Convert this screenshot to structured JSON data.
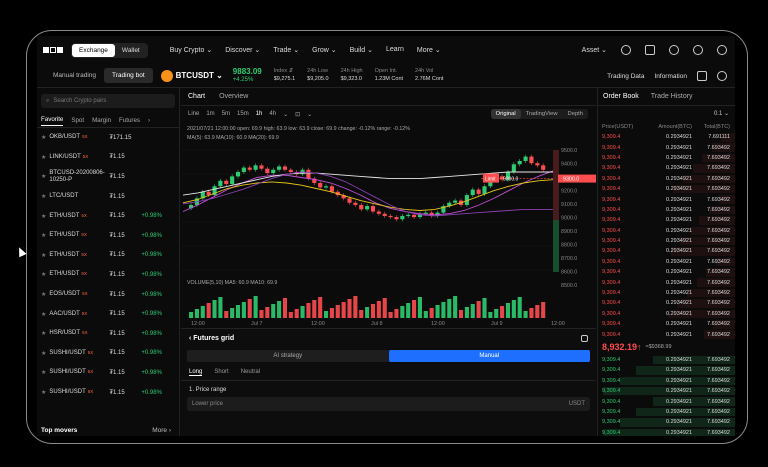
{
  "nav": {
    "mode_tabs": [
      "Exchange",
      "Wallet"
    ],
    "menu": [
      "Buy Crypto ⌄",
      "Discover ⌄",
      "Trade ⌄",
      "Grow ⌄",
      "Build ⌄",
      "Learn",
      "More ⌄"
    ],
    "asset": "Asset ⌄"
  },
  "ticker": {
    "tabs": [
      "Manual trading",
      "Trading bot"
    ],
    "pair": "BTCUSDT ⌄",
    "last_price": "9883.09",
    "change": "+4.25%",
    "stats": [
      {
        "k": "Index ⇵",
        "v": "$9,275.1"
      },
      {
        "k": "24h Low",
        "v": "$9,205.0"
      },
      {
        "k": "24h High",
        "v": "$9,323.0"
      },
      {
        "k": "Open Int.",
        "v": "1.23M Cont"
      },
      {
        "k": "24h Vol",
        "v": "2.76M Cont"
      }
    ],
    "right": [
      "Trading Data",
      "Information"
    ]
  },
  "left": {
    "search_placeholder": "Search Crypto pairs",
    "tabs": [
      "Favorite",
      "Spot",
      "Margin",
      "Futures"
    ],
    "rows": [
      {
        "name": "OKB/USDT",
        "lev": "5X",
        "price": "₮171.15",
        "change": ""
      },
      {
        "name": "LINK/USDT",
        "lev": "5X",
        "price": "₮1.15",
        "change": ""
      },
      {
        "name": "BTCUSD-20200806-10250-P",
        "lev": "",
        "price": "₮1.15",
        "change": ""
      },
      {
        "name": "LTC/USDT",
        "lev": "",
        "price": "₮1.15",
        "change": ""
      },
      {
        "name": "ETH/USDT",
        "lev": "5X",
        "price": "₮1.15",
        "change": "+0.98%"
      },
      {
        "name": "ETH/USDT",
        "lev": "5X",
        "price": "₮1.15",
        "change": "+0.98%"
      },
      {
        "name": "ETH/USDT",
        "lev": "5X",
        "price": "₮1.15",
        "change": "+0.98%"
      },
      {
        "name": "ETH/USDT",
        "lev": "5X",
        "price": "₮1.15",
        "change": "+0.98%"
      },
      {
        "name": "EOS/USDT",
        "lev": "5X",
        "price": "₮1.15",
        "change": "+0.98%"
      },
      {
        "name": "AAC/USDT",
        "lev": "5X",
        "price": "₮1.15",
        "change": "+0.98%"
      },
      {
        "name": "HSR/USDT",
        "lev": "5X",
        "price": "₮1.15",
        "change": "+0.98%"
      },
      {
        "name": "SUSHI/USDT",
        "lev": "5X",
        "price": "₮1.15",
        "change": "+0.98%"
      },
      {
        "name": "SUSHI/USDT",
        "lev": "5X",
        "price": "₮1.15",
        "change": "+0.98%"
      },
      {
        "name": "SUSHI/USDT",
        "lev": "5X",
        "price": "₮1.15",
        "change": "+0.98%"
      }
    ],
    "top_movers": "Top movers",
    "more": "More ›"
  },
  "center": {
    "tabs": [
      "Chart",
      "Overview"
    ],
    "intervals": [
      "Line",
      "1m",
      "5m",
      "15m",
      "1h",
      "4h",
      "⌄",
      "⊡",
      "⌄"
    ],
    "views": [
      "Original",
      "TradingView",
      "Depth"
    ],
    "ohlc": "2021/07/21 12:00:00   open: 69.9   high: 63.9   low: 63.9   close: 69.9   change: -0.12%   range: -0.12%",
    "ma_line": "MA(5): 63.9   MA(10): 60.9   MA(20): 69.9",
    "vol_line": "VOLUME(5,10)   MA5: 60.9   MA10: 69.9",
    "limit_label": "Limit",
    "limit_price": "9300.0"
  },
  "chart_data": {
    "type": "line",
    "title": "",
    "x_labels": [
      "12:00",
      "Jul 7",
      "12:00",
      "Jul 8",
      "12:00",
      "Jul 9",
      "12:00"
    ],
    "y_labels": [
      "9500.0",
      "9400.0",
      "9300.0",
      "9200.0",
      "9100.0",
      "9000.0",
      "8900.0",
      "8800.0",
      "8700.0",
      "8600.0",
      "8500.0"
    ],
    "price_tag": "9300.0",
    "ylim": [
      8450,
      9560
    ],
    "x_range": [
      0,
      100
    ],
    "candles_close": [
      9060,
      9120,
      9180,
      9150,
      9230,
      9280,
      9250,
      9320,
      9360,
      9400,
      9380,
      9420,
      9390,
      9350,
      9380,
      9410,
      9380,
      9360,
      9340,
      9380,
      9300,
      9260,
      9220,
      9230,
      9180,
      9150,
      9120,
      9080,
      9060,
      9020,
      9050,
      9000,
      8980,
      8960,
      8950,
      8930,
      8960,
      8970,
      8950,
      8980,
      8990,
      8960,
      8990,
      9050,
      9080,
      9100,
      9060,
      9150,
      9200,
      9160,
      9230,
      9280,
      9320,
      9290,
      9360,
      9430,
      9460,
      9500,
      9440,
      9420,
      9380
    ],
    "series": [
      {
        "name": "MA(5)",
        "values": [
          9000,
          9060,
          9130,
          9200,
          9260,
          9310,
          9330,
          9330,
          9310,
          9290,
          9260,
          9210,
          9150,
          9080,
          9030,
          9000,
          8980,
          8970,
          8980,
          9010,
          9060,
          9120,
          9190,
          9260,
          9320,
          9370
        ]
      },
      {
        "name": "MA(10)",
        "values": [
          9080,
          9110,
          9160,
          9210,
          9240,
          9260,
          9270,
          9260,
          9240,
          9210,
          9180,
          9140,
          9100,
          9070,
          9040,
          9020,
          9010,
          9020,
          9050,
          9090,
          9140,
          9190,
          9230,
          9260,
          9280,
          9290
        ]
      },
      {
        "name": "MA(20)",
        "values": [
          9150,
          9170,
          9200,
          9230,
          9260,
          9290,
          9320,
          9340,
          9350,
          9350,
          9340,
          9330,
          9320,
          9310,
          9300,
          9300,
          9300,
          9310,
          9320,
          9330,
          9340,
          9350,
          9360,
          9360,
          9360,
          9360
        ]
      },
      {
        "name": "MA(30)",
        "values": [
          9070,
          9090,
          9120,
          9160,
          9200,
          9250,
          9300,
          9340,
          9360,
          9350,
          9320,
          9270,
          9200,
          9130,
          9060,
          9000,
          8970,
          8960,
          8970,
          8980,
          8990,
          9000,
          9010,
          9020,
          9020,
          9020
        ]
      }
    ]
  },
  "grid": {
    "title": "‹  Futures grid",
    "modes": [
      "AI strategy",
      "Manual"
    ],
    "tabs": [
      "Long",
      "Short",
      "Neutral"
    ],
    "section": "1. Price range",
    "lower_placeholder": "Lower price",
    "unit": "USDT"
  },
  "right": {
    "tabs": [
      "Order Book",
      "Trade History"
    ],
    "step": "0.1 ⌄",
    "headers": [
      "Price(USDT)",
      "Amount(BTC)",
      "Total(BTC)"
    ],
    "asks": [
      [
        "9,309.4",
        "0.2934921",
        "7.691111"
      ],
      [
        "9,309.4",
        "0.2934921",
        "7.693492"
      ],
      [
        "9,309.4",
        "0.2934921",
        "7.693492"
      ],
      [
        "9,309.4",
        "0.2934921",
        "7.693492"
      ],
      [
        "9,309.4",
        "0.2934921",
        "7.693492"
      ],
      [
        "9,309.4",
        "0.2934921",
        "7.693492"
      ],
      [
        "9,309.4",
        "0.2934921",
        "7.693492"
      ],
      [
        "9,309.4",
        "0.2934921",
        "7.693492"
      ],
      [
        "9,309.4",
        "0.2934921",
        "7.693492"
      ],
      [
        "9,309.4",
        "0.2934921",
        "7.693492"
      ],
      [
        "9,309.4",
        "0.2934921",
        "7.693492"
      ],
      [
        "9,309.4",
        "0.2934921",
        "7.693492"
      ],
      [
        "9,309.4",
        "0.2934921",
        "7.693492"
      ],
      [
        "9,309.4",
        "0.2934921",
        "7.693492"
      ],
      [
        "9,309.4",
        "0.2934921",
        "7.693492"
      ],
      [
        "9,309.4",
        "0.2934921",
        "7.693492"
      ],
      [
        "9,309.4",
        "0.2934921",
        "7.693492"
      ],
      [
        "9,309.4",
        "0.2934921",
        "7.693492"
      ],
      [
        "9,309.4",
        "0.2934921",
        "7.693492"
      ],
      [
        "9,309.4",
        "0.2934921",
        "7.693492"
      ]
    ],
    "mid_price": "8,932.19↑",
    "mid_index": "≈$9368.99",
    "bids": [
      [
        "9,309.4",
        "0.2934921",
        "7.693492"
      ],
      [
        "9,309.4",
        "0.2934921",
        "7.693492"
      ],
      [
        "9,309.4",
        "0.2934921",
        "7.693492"
      ],
      [
        "9,309.4",
        "0.2934921",
        "7.693492"
      ],
      [
        "9,309.4",
        "0.2934921",
        "7.693492"
      ],
      [
        "9,309.4",
        "0.2934921",
        "7.693492"
      ],
      [
        "9,309.4",
        "0.2934921",
        "7.693492"
      ],
      [
        "9,309.4",
        "0.2934921",
        "7.693492"
      ],
      [
        "9,309.4",
        "0.2934921",
        "7.693492"
      ],
      [
        "9,309.4",
        "0.2934921",
        "7.693492"
      ]
    ]
  },
  "colors": {
    "up": "#2ecc71",
    "down": "#ff4d4f",
    "accent": "#1f6fff",
    "ma5": "#c44ed8",
    "ma10": "#e6c619",
    "ma20": "#e8e8e8",
    "ma30": "#8a3fb0"
  }
}
